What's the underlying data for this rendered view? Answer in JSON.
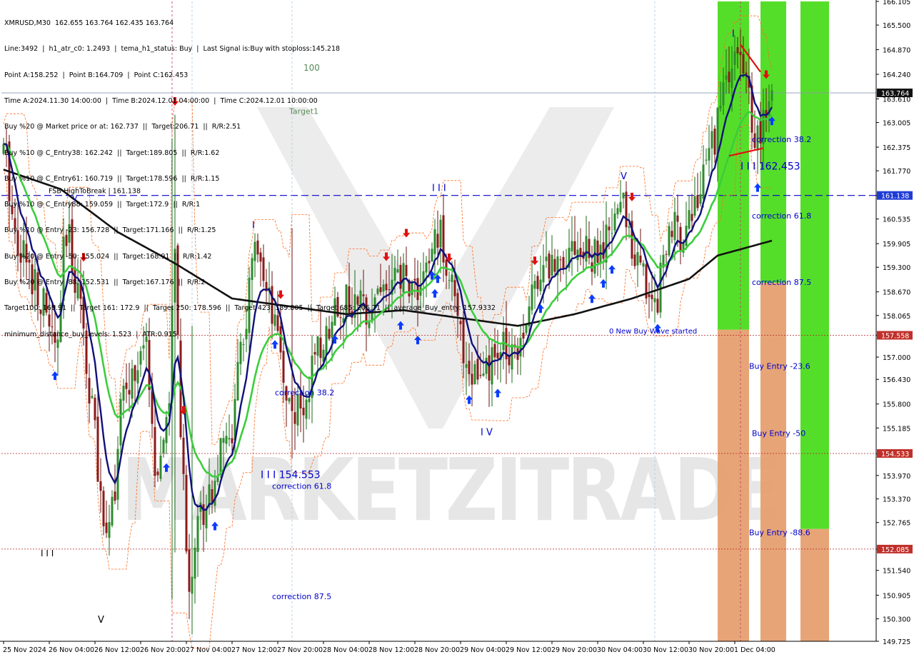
{
  "info_panel": {
    "lines": [
      "XMRUSD,M30  162.655 163.764 162.435 163.764",
      "Line:3492  |  h1_atr_c0: 1.2493  |  tema_h1_status: Buy  |  Last Signal is:Buy with stoploss:145.218",
      "Point A:158.252  |  Point B:164.709  |  Point C:162.453",
      "Time A:2024.11.30 14:00:00  |  Time B:2024.12.01 04:00:00  |  Time C:2024.12.01 10:00:00",
      "Buy %20 @ Market price or at: 162.737  ||  Target:206.71  ||  R/R:2.51",
      "Buy %10 @ C_Entry38: 162.242  ||  Target:189.805  ||  R/R:1.62",
      "Buy %10 @ C_Entry61: 160.719  ||  Target:178.596  ||  R/R:1.15",
      "Buy %10 @ C_Entry88: 159.059  ||  Target:172.9  ||  R/R:1",
      "Buy %10 @ Entry -23: 156.728  ||  Target:171.166  ||  R/R:1.25",
      "Buy %20 @ Entry -50: 155.024  ||  Target:168.91  ||  R/R:1.42",
      "Buy %20 @ Entry -88: 152.531  ||  Target:167.176  ||  R/R:2",
      "Target100: 168.91  ||  Target 161: 172.9  ||  Target 250: 178.596  ||  Target 423: 189.805  ||  Target 685: 206.71  ||  average_Buy_entry: 157.9332",
      "minimum_distance_buy_levels: 1.523  |  ATR:0.915"
    ]
  },
  "chart_data": {
    "type": "candlestick",
    "symbol": "XMRUSD",
    "timeframe": "M30",
    "ylim": [
      149.725,
      166.105
    ],
    "y_ticks": [
      "166.105",
      "165.500",
      "164.870",
      "164.240",
      "163.610",
      "163.005",
      "162.375",
      "161.770",
      "161.138",
      "160.535",
      "159.905",
      "159.300",
      "158.670",
      "158.065",
      "157.558",
      "157.000",
      "156.430",
      "155.800",
      "155.185",
      "154.533",
      "153.970",
      "153.370",
      "152.765",
      "152.085",
      "151.540",
      "150.905",
      "150.300",
      "149.725"
    ],
    "y_tick_values": [
      166.105,
      165.5,
      164.87,
      164.24,
      163.61,
      163.005,
      162.375,
      161.77,
      161.138,
      160.535,
      159.905,
      159.3,
      158.67,
      158.065,
      157.558,
      157.0,
      156.43,
      155.8,
      155.185,
      154.533,
      153.97,
      153.37,
      152.765,
      152.085,
      151.54,
      150.905,
      150.3,
      149.725
    ],
    "x_ticks": [
      "25 Nov 2024",
      "26 Nov 04:00",
      "26 Nov 12:00",
      "26 Nov 20:00",
      "27 Nov 04:00",
      "27 Nov 12:00",
      "27 Nov 20:00",
      "28 Nov 04:00",
      "28 Nov 12:00",
      "28 Nov 20:00",
      "29 Nov 04:00",
      "29 Nov 12:00",
      "29 Nov 20:00",
      "30 Nov 04:00",
      "30 Nov 12:00",
      "30 Nov 20:00",
      "1 Dec 04:00"
    ],
    "x_tick_index": [
      0,
      16,
      32,
      48,
      64,
      80,
      96,
      112,
      128,
      144,
      160,
      176,
      192,
      208,
      224,
      240,
      256
    ],
    "bar_count": 270,
    "current_price": {
      "label": "163.764",
      "value": 163.764
    },
    "horizontal_levels": [
      {
        "label": "161.138",
        "value": 161.138,
        "style": "dashed",
        "color": "#0000cc",
        "text": "FSB-HighToBreak  |  161.138"
      },
      {
        "label": "157.558",
        "value": 157.558,
        "style": "dotted",
        "color": "#b22222"
      },
      {
        "label": "154.533",
        "value": 154.533,
        "style": "dotted",
        "color": "#b22222"
      },
      {
        "label": "152.085",
        "value": 152.085,
        "style": "dotted",
        "color": "#b22222"
      }
    ],
    "zones": [
      {
        "bar_from": 250,
        "bar_to": 261,
        "green_from": 157.7,
        "green_to": 166.105,
        "orange_from": 149.725,
        "orange_to": 157.7
      },
      {
        "bar_from": 265,
        "bar_to": 274,
        "green_from": 158.9,
        "green_to": 166.105,
        "orange_from": 149.725,
        "orange_to": 158.9
      },
      {
        "bar_from": 279,
        "bar_to": 289,
        "green_from": 152.6,
        "green_to": 166.105,
        "orange_from": 149.725,
        "orange_to": 152.6
      }
    ],
    "annotations": [
      {
        "text": "100",
        "bar": 105,
        "price": 164.33,
        "color": "#5a8a5a",
        "size": 12
      },
      {
        "text": "Target1",
        "bar": 100,
        "price": 163.23,
        "color": "#5a8a5a",
        "size": 11
      },
      {
        "text": "I",
        "bar": 87,
        "price": 160.3,
        "color": "#0000cc",
        "size": 13
      },
      {
        "text": "I I I",
        "bar": 150,
        "price": 161.25,
        "color": "#0000cc",
        "size": 13
      },
      {
        "text": "V",
        "bar": 216,
        "price": 161.55,
        "color": "#0000cc",
        "size": 13
      },
      {
        "text": "V",
        "bar": 24,
        "price": 161.0,
        "color": "#0000cc",
        "size": 11
      },
      {
        "text": "I",
        "bar": 255,
        "price": 165.2,
        "color": "#0000cc",
        "size": 13
      },
      {
        "text": "I I I 162.453",
        "bar": 258,
        "price": 161.8,
        "color": "#0000cc",
        "size": 14
      },
      {
        "text": "correction 38.2",
        "bar": 262,
        "price": 162.5,
        "color": "#0000cc",
        "size": 11
      },
      {
        "text": "correction 61.8",
        "bar": 262,
        "price": 160.55,
        "color": "#0000cc",
        "size": 11
      },
      {
        "text": "correction 87.5",
        "bar": 262,
        "price": 158.85,
        "color": "#0000cc",
        "size": 11
      },
      {
        "text": "0 New Buy Wave started",
        "bar": 212,
        "price": 157.6,
        "color": "#0000cc",
        "size": 10
      },
      {
        "text": "Buy Entry -23.6",
        "bar": 261,
        "price": 156.7,
        "color": "#0000cc",
        "size": 11
      },
      {
        "text": "Buy Entry -50",
        "bar": 262,
        "price": 154.98,
        "color": "#0000cc",
        "size": 11
      },
      {
        "text": "Buy Entry -88.6",
        "bar": 261,
        "price": 152.44,
        "color": "#0000cc",
        "size": 11
      },
      {
        "text": "I I I 154.553",
        "bar": 90,
        "price": 153.9,
        "color": "#0000cc",
        "size": 14
      },
      {
        "text": "correction 61.8",
        "bar": 94,
        "price": 153.63,
        "color": "#0000cc",
        "size": 11
      },
      {
        "text": "correction 87.5",
        "bar": 94,
        "price": 150.8,
        "color": "#0000cc",
        "size": 11
      },
      {
        "text": "correction 38.2",
        "bar": 95,
        "price": 156.02,
        "color": "#0000cc",
        "size": 11
      },
      {
        "text": "I V",
        "bar": 167,
        "price": 155.0,
        "color": "#0000cc",
        "size": 13
      },
      {
        "text": "I I I",
        "bar": 13,
        "price": 151.9,
        "color": "#000000",
        "size": 12
      },
      {
        "text": "V",
        "bar": 33,
        "price": 150.2,
        "color": "#000000",
        "size": 13
      }
    ],
    "watermark_text": "MARKETZITRADE"
  }
}
